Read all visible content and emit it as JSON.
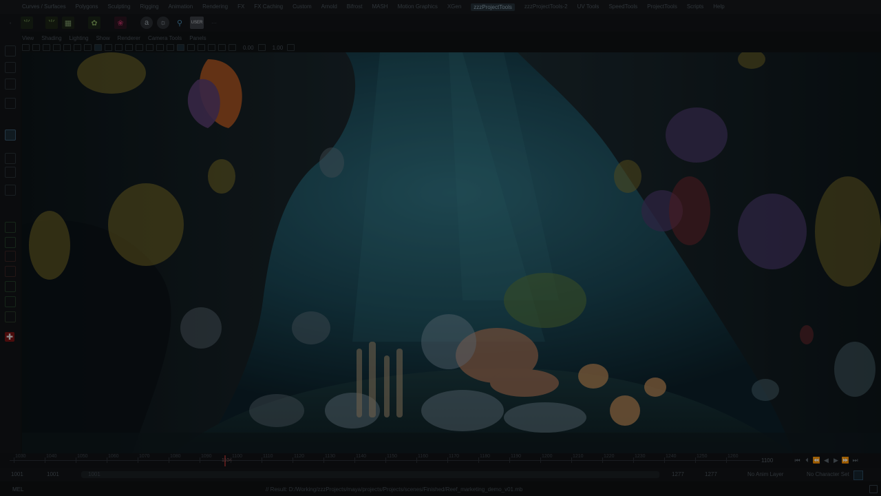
{
  "menubar": {
    "items": [
      "Curves / Surfaces",
      "Polygons",
      "Sculpting",
      "Rigging",
      "Animation",
      "Rendering",
      "FX",
      "FX Caching",
      "Custom",
      "Arnold",
      "Bifrost",
      "MASH",
      "Motion Graphics",
      "XGen",
      "zzzProjectTools",
      "zzzProjectTools-2",
      "UV Tools",
      "SpeedTools",
      "ProjectTools",
      "Scripts",
      "Help"
    ],
    "active_index": 14
  },
  "shelf": {
    "icons": [
      "grass-icon",
      "grass-paint-icon",
      "grid-icon",
      "plant-icon",
      "reef-icon",
      "arnold-icon",
      "arnold-light-icon",
      "search-icon",
      "user-icon"
    ],
    "user_label": "USER"
  },
  "panel_menu": [
    "View",
    "Shading",
    "Lighting",
    "Show",
    "Renderer",
    "Camera Tools",
    "Panels"
  ],
  "viewport_toolbar": {
    "exposure": "0.00",
    "gamma": "1.00"
  },
  "timeline": {
    "ticks": [
      "1030",
      "1040",
      "1050",
      "1060",
      "1070",
      "1080",
      "1090",
      "1100",
      "1110",
      "1120",
      "1130",
      "1140",
      "1150",
      "1160",
      "1170",
      "1180",
      "1190",
      "1200",
      "1210",
      "1220",
      "1230",
      "1240",
      "1250",
      "1260"
    ],
    "current_frame": "1100",
    "cursor_label": "1104"
  },
  "range": {
    "start": "1001",
    "start_inner": "1001",
    "bar_label": "1001",
    "end_inner": "1277",
    "end": "1277",
    "anim_layer": "No Anim Layer",
    "character_set": "No Character Set"
  },
  "playback_controls": [
    "go-to-start-icon",
    "step-back-key-icon",
    "step-back-frame-icon",
    "play-back-icon",
    "play-forward-icon",
    "step-forward-frame-icon",
    "go-to-end-icon"
  ],
  "command_line": {
    "language": "MEL",
    "result": "// Result: D:/Working/zzzProjects/maya/projects/Projects/scenes/Finished/Reef_marketing_demo_v01.mb"
  },
  "colors": {
    "water_deep": "#0f2a36",
    "water_light": "#2d6a7a",
    "coral_orange": "#c4602a",
    "coral_purple": "#5a3e70",
    "sea_fan_yellow": "#8a7a2a",
    "timeline_cursor": "#8a2a2a"
  }
}
